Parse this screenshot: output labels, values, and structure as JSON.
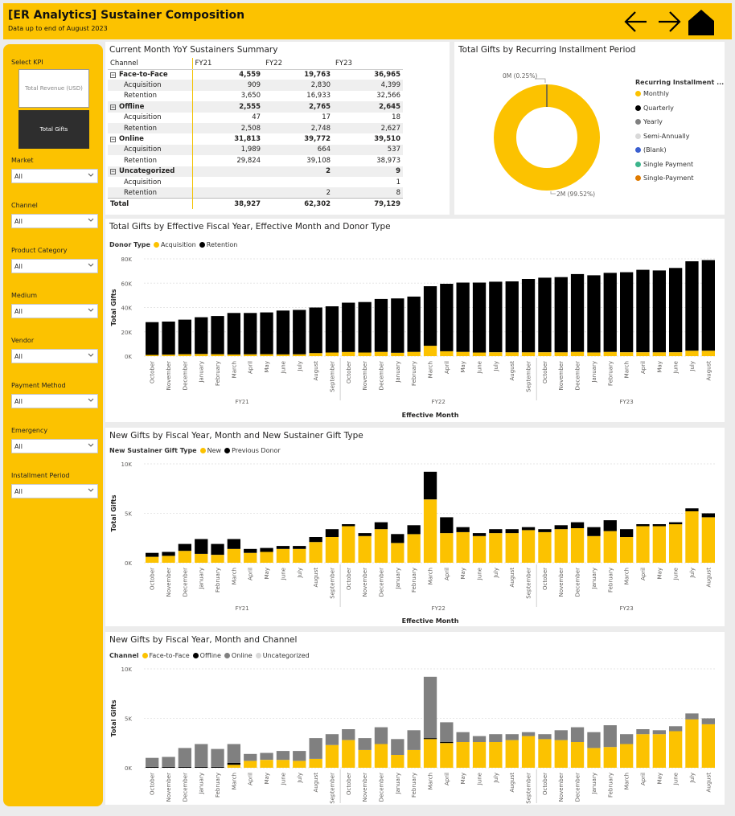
{
  "header": {
    "title": "[ER Analytics] Sustainer Composition",
    "subtitle": "Data up to end of August 2023"
  },
  "sidebar": {
    "kpi_label": "Select KPI",
    "kpi_options": [
      "Total Revenue (USD)",
      "Total Gifts"
    ],
    "kpi_selected": "Total Gifts",
    "filters": [
      {
        "label": "Market",
        "value": "All"
      },
      {
        "label": "Channel",
        "value": "All"
      },
      {
        "label": "Product Category",
        "value": "All"
      },
      {
        "label": "Medium",
        "value": "All"
      },
      {
        "label": "Vendor",
        "value": "All"
      },
      {
        "label": "Payment Method",
        "value": "All"
      },
      {
        "label": "Emergency",
        "value": "All"
      },
      {
        "label": "Installment Period",
        "value": "All"
      }
    ]
  },
  "summary": {
    "title": "Current Month YoY Sustainers Summary",
    "columns": [
      "Channel",
      "FY21",
      "FY22",
      "FY23"
    ],
    "rows": [
      {
        "type": "group",
        "cells": [
          "Face-to-Face",
          "4,559",
          "19,763",
          "36,965"
        ]
      },
      {
        "type": "sub",
        "cells": [
          "Acquisition",
          "909",
          "2,830",
          "4,399"
        ]
      },
      {
        "type": "sub",
        "cells": [
          "Retention",
          "3,650",
          "16,933",
          "32,566"
        ]
      },
      {
        "type": "group",
        "cells": [
          "Offline",
          "2,555",
          "2,765",
          "2,645"
        ]
      },
      {
        "type": "sub",
        "cells": [
          "Acquisition",
          "47",
          "17",
          "18"
        ]
      },
      {
        "type": "sub",
        "cells": [
          "Retention",
          "2,508",
          "2,748",
          "2,627"
        ]
      },
      {
        "type": "group",
        "cells": [
          "Online",
          "31,813",
          "39,772",
          "39,510"
        ]
      },
      {
        "type": "sub",
        "cells": [
          "Acquisition",
          "1,989",
          "664",
          "537"
        ]
      },
      {
        "type": "sub",
        "cells": [
          "Retention",
          "29,824",
          "39,108",
          "38,973"
        ]
      },
      {
        "type": "group",
        "cells": [
          "Uncategorized",
          "",
          "2",
          "9"
        ]
      },
      {
        "type": "sub",
        "cells": [
          "Acquisition",
          "",
          "",
          "1"
        ]
      },
      {
        "type": "sub",
        "cells": [
          "Retention",
          "",
          "2",
          "8"
        ]
      },
      {
        "type": "total",
        "cells": [
          "Total",
          "38,927",
          "62,302",
          "79,129"
        ]
      }
    ]
  },
  "donut": {
    "title": "Total Gifts by Recurring Installment Period",
    "small_label": "0M (0.25%)",
    "big_label": "2M (99.52%)",
    "legend_title": "Recurring Installment ...",
    "legend": [
      {
        "name": "Monthly",
        "color": "#fcc200"
      },
      {
        "name": "Quarterly",
        "color": "#000000"
      },
      {
        "name": "Yearly",
        "color": "#808080"
      },
      {
        "name": "Semi-Annually",
        "color": "#d9d9d9"
      },
      {
        "name": "(Blank)",
        "color": "#3b5fd0"
      },
      {
        "name": "Single Payment",
        "color": "#3cb48c"
      },
      {
        "name": "Single-Payment",
        "color": "#e07b00"
      }
    ]
  },
  "chart_data": [
    {
      "type": "bar",
      "stacked": true,
      "title": "Total Gifts by Effective Fiscal Year, Effective Month and Donor Type",
      "legend_title": "Donor Type",
      "xlabel": "Effective Month",
      "ylabel": "Total Gifts",
      "yticks": [
        "0K",
        "20K",
        "40K",
        "60K",
        "80K"
      ],
      "ylim": [
        0,
        80000
      ],
      "categories": [
        "October",
        "November",
        "December",
        "January",
        "February",
        "March",
        "April",
        "May",
        "June",
        "July",
        "August",
        "September",
        "October",
        "November",
        "December",
        "January",
        "February",
        "March",
        "April",
        "May",
        "June",
        "July",
        "August",
        "September",
        "October",
        "November",
        "December",
        "January",
        "February",
        "March",
        "April",
        "May",
        "June",
        "July",
        "August"
      ],
      "groups": [
        {
          "label": "FY21",
          "count": 12
        },
        {
          "label": "FY22",
          "count": 12
        },
        {
          "label": "FY23",
          "count": 11
        }
      ],
      "series": [
        {
          "name": "Acquisition",
          "color": "#fcc200",
          "values": [
            1000,
            1200,
            1600,
            1800,
            1600,
            1400,
            1500,
            1600,
            1500,
            1500,
            2500,
            3000,
            3500,
            3000,
            3500,
            2800,
            3500,
            8500,
            4000,
            3500,
            3000,
            3200,
            3200,
            3200,
            3200,
            3200,
            3500,
            3000,
            3500,
            3200,
            3200,
            3200,
            3200,
            4500,
            4500
          ]
        },
        {
          "name": "Retention",
          "color": "#000000",
          "values": [
            27000,
            27200,
            28400,
            30200,
            31400,
            34100,
            34000,
            34400,
            36000,
            36500,
            37500,
            38000,
            40500,
            41500,
            43500,
            44700,
            45500,
            49000,
            55500,
            57000,
            57500,
            58000,
            58300,
            60300,
            61300,
            61800,
            64000,
            63500,
            65000,
            65800,
            67800,
            67300,
            69300,
            73500,
            74500
          ]
        }
      ]
    },
    {
      "type": "bar",
      "stacked": true,
      "title": "New Gifts by Fiscal Year, Month and New Sustainer Gift Type",
      "legend_title": "New Sustainer Gift Type",
      "xlabel": "Effective Month",
      "ylabel": "Total Gifts",
      "yticks": [
        "0K",
        "5K",
        "10K"
      ],
      "ylim": [
        0,
        10000
      ],
      "categories": [
        "October",
        "November",
        "December",
        "January",
        "February",
        "March",
        "April",
        "May",
        "June",
        "July",
        "August",
        "September",
        "October",
        "November",
        "December",
        "January",
        "February",
        "March",
        "April",
        "May",
        "June",
        "July",
        "August",
        "September",
        "October",
        "November",
        "December",
        "January",
        "February",
        "March",
        "April",
        "May",
        "June",
        "July",
        "August"
      ],
      "groups": [
        {
          "label": "FY21",
          "count": 12
        },
        {
          "label": "FY22",
          "count": 12
        },
        {
          "label": "FY23",
          "count": 11
        }
      ],
      "series": [
        {
          "name": "New",
          "color": "#fcc200",
          "values": [
            600,
            700,
            1200,
            900,
            800,
            1400,
            1000,
            1100,
            1400,
            1400,
            2100,
            2600,
            3700,
            2700,
            3400,
            2000,
            2900,
            6400,
            3000,
            3100,
            2700,
            3000,
            3000,
            3300,
            3100,
            3400,
            3500,
            2700,
            3200,
            2600,
            3700,
            3700,
            3900,
            5200,
            4600
          ]
        },
        {
          "name": "Previous Donor",
          "color": "#000000",
          "values": [
            400,
            400,
            700,
            1500,
            1100,
            1000,
            400,
            400,
            300,
            300,
            500,
            800,
            200,
            300,
            700,
            900,
            900,
            2800,
            1600,
            500,
            300,
            400,
            400,
            300,
            300,
            400,
            600,
            900,
            1100,
            800,
            200,
            200,
            200,
            300,
            400
          ]
        }
      ]
    },
    {
      "type": "bar",
      "stacked": true,
      "title": "New Gifts by Fiscal Year, Month and Channel",
      "legend_title": "Channel",
      "xlabel": "",
      "ylabel": "Total Gifts",
      "yticks": [
        "0K",
        "5K",
        "10K"
      ],
      "ylim": [
        0,
        10000
      ],
      "categories": [
        "October",
        "November",
        "December",
        "January",
        "February",
        "March",
        "April",
        "May",
        "June",
        "July",
        "August",
        "September",
        "October",
        "November",
        "December",
        "January",
        "February",
        "March",
        "April",
        "May",
        "June",
        "July",
        "August",
        "September",
        "October",
        "November",
        "December",
        "January",
        "February",
        "March",
        "April",
        "May",
        "June",
        "July",
        "August"
      ],
      "groups": [
        {
          "label": "FY21",
          "count": 12
        },
        {
          "label": "FY22",
          "count": 12
        },
        {
          "label": "FY23",
          "count": 11
        }
      ],
      "series": [
        {
          "name": "Face-to-Face",
          "color": "#fcc200",
          "values": [
            0,
            0,
            0,
            0,
            0,
            300,
            700,
            800,
            800,
            700,
            900,
            2300,
            2800,
            1800,
            2400,
            1300,
            1800,
            2900,
            2500,
            2600,
            2600,
            2600,
            2800,
            3200,
            2900,
            2800,
            2600,
            2000,
            2100,
            2400,
            3400,
            3400,
            3700,
            4900,
            4400
          ]
        },
        {
          "name": "Offline",
          "color": "#000000",
          "values": [
            100,
            100,
            100,
            100,
            100,
            200,
            0,
            0,
            0,
            0,
            0,
            0,
            0,
            0,
            0,
            0,
            0,
            100,
            100,
            0,
            0,
            0,
            0,
            0,
            0,
            0,
            0,
            0,
            0,
            0,
            0,
            0,
            0,
            0,
            0
          ]
        },
        {
          "name": "Online",
          "color": "#808080",
          "values": [
            900,
            1000,
            1900,
            2300,
            1800,
            1900,
            700,
            700,
            900,
            1000,
            2100,
            1100,
            1100,
            1200,
            1700,
            1600,
            2000,
            6200,
            2000,
            1000,
            600,
            800,
            600,
            400,
            500,
            1000,
            1500,
            1600,
            2200,
            1000,
            500,
            400,
            500,
            600,
            600
          ]
        },
        {
          "name": "Uncategorized",
          "color": "#d9d9d9",
          "values": [
            0,
            0,
            0,
            0,
            0,
            0,
            0,
            0,
            0,
            0,
            0,
            0,
            0,
            0,
            0,
            0,
            0,
            0,
            0,
            0,
            0,
            0,
            0,
            0,
            0,
            0,
            0,
            0,
            0,
            0,
            0,
            0,
            0,
            0,
            0
          ]
        }
      ]
    }
  ]
}
